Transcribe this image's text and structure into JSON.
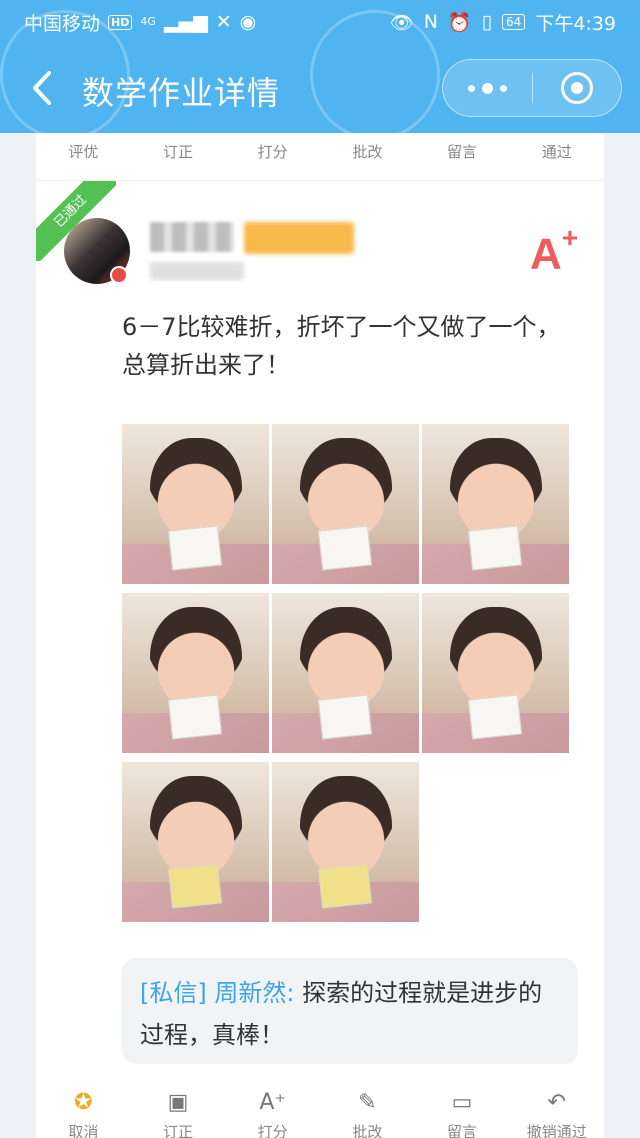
{
  "status_bar": {
    "carrier": "中国移动",
    "hd": "HD",
    "network": "4G",
    "battery": "64",
    "time": "下午4:39"
  },
  "header": {
    "title": "数学作业详情"
  },
  "top_actions": [
    "评优",
    "订正",
    "打分",
    "批改",
    "留言",
    "通过"
  ],
  "post": {
    "status_badge": "已通过",
    "grade": "A",
    "grade_suffix": "+",
    "content": "6－7比较难折，折坏了一个又做了一个，总算折出来了！",
    "photo_count": 8
  },
  "comment": {
    "prefix": "[私信] 周新然:",
    "text": "探索的过程就是进步的过程，真棒！"
  },
  "bottom_actions": [
    {
      "label": "取消",
      "icon": "medal-icon"
    },
    {
      "label": "订正",
      "icon": "edit-x-icon"
    },
    {
      "label": "打分",
      "icon": "a-plus-icon"
    },
    {
      "label": "批改",
      "icon": "pencil-icon"
    },
    {
      "label": "留言",
      "icon": "chat-icon"
    },
    {
      "label": "撤销通过",
      "icon": "undo-icon"
    }
  ],
  "colors": {
    "header_bg": "#4fb4ef",
    "grade": "#ee5c5c",
    "badge": "#53c253",
    "comment_name": "#3aa5e8"
  }
}
